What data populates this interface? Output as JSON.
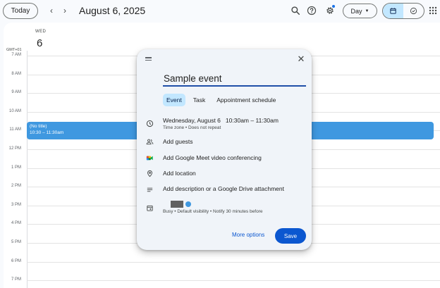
{
  "header": {
    "today_label": "Today",
    "prev_icon": "chevron-left-icon",
    "next_icon": "chevron-right-icon",
    "date_title": "August 6, 2025",
    "view_label": "Day",
    "accent_color": "#c2e7ff"
  },
  "day": {
    "weekday": "WED",
    "date_number": "6",
    "timezone": "GMT+01"
  },
  "hours": [
    "7 AM",
    "8 AM",
    "9 AM",
    "10 AM",
    "11 AM",
    "12 PM",
    "1 PM",
    "2 PM",
    "3 PM",
    "4 PM",
    "5 PM",
    "6 PM",
    "7 PM"
  ],
  "existing_event": {
    "title": "(No title)",
    "time": "10:30 – 11:30am",
    "color": "#3f98e0"
  },
  "dialog": {
    "title_value": "Sample event",
    "tabs": [
      {
        "label": "Event",
        "active": true
      },
      {
        "label": "Task",
        "active": false
      },
      {
        "label": "Appointment schedule",
        "active": false
      }
    ],
    "date_text": "Wednesday, August 6",
    "start_time": "10:30am",
    "time_separator": "–",
    "end_time": "11:30am",
    "time_sub": "Time zone • Does not repeat",
    "add_guests": "Add guests",
    "add_meet": "Add Google Meet video conferencing",
    "add_location": "Add location",
    "add_description": "Add description or a Google Drive attachment",
    "status_sub": "Busy • Default visibility • Notify 30 minutes before",
    "more_options": "More options",
    "save": "Save",
    "save_color": "#0b57d0"
  }
}
